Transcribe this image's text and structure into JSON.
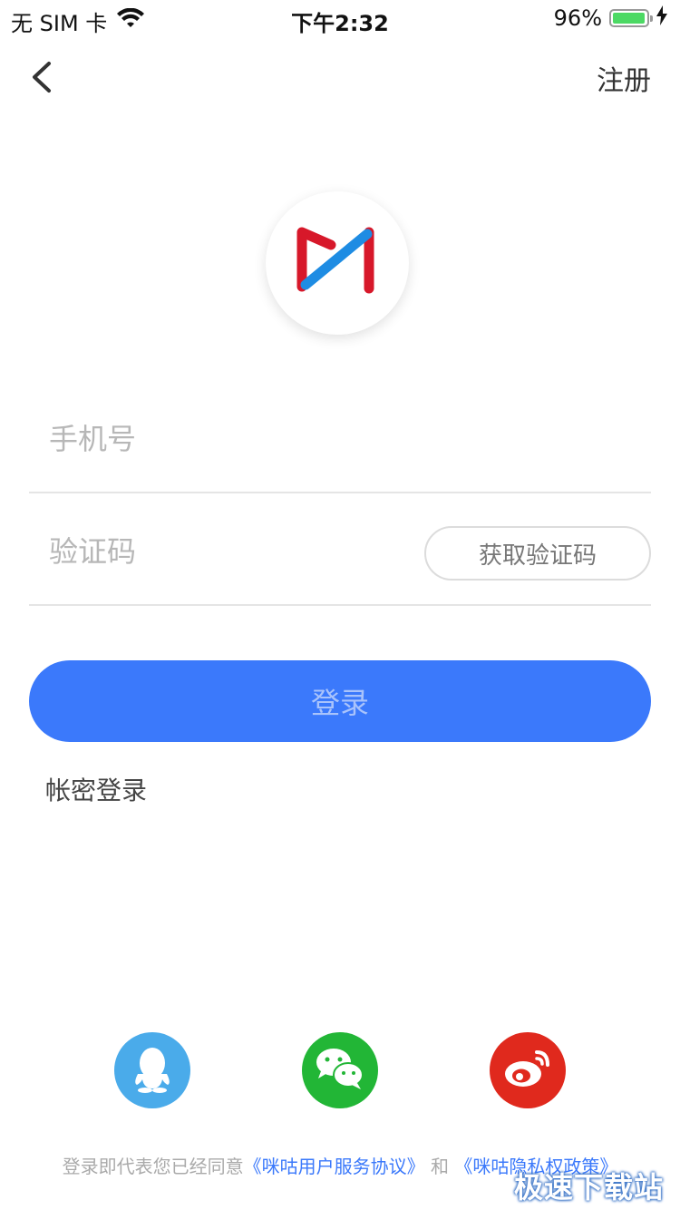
{
  "status_bar": {
    "carrier": "无 SIM 卡",
    "time": "下午2:32",
    "battery_text": "96%",
    "battery_level": 0.96,
    "battery_color": "#4cd964"
  },
  "nav": {
    "back_icon": "chevron-left-icon",
    "register_label": "注册"
  },
  "logo": {
    "name": "migu-logo-icon",
    "red": "#d7182a",
    "blue": "#1e8ce3"
  },
  "form": {
    "phone_placeholder": "手机号",
    "code_placeholder": "验证码",
    "get_code_label": "获取验证码",
    "login_label": "登录",
    "password_login_label": "帐密登录"
  },
  "social": [
    {
      "name": "qq-icon",
      "color": "#4aabea"
    },
    {
      "name": "wechat-icon",
      "color": "#22b636"
    },
    {
      "name": "weibo-icon",
      "color": "#e0291d"
    }
  ],
  "agreement": {
    "prefix": "登录即代表您已经同意",
    "user_agreement": "《咪咕用户服务协议》",
    "conjunction": "和",
    "privacy_policy": "《咪咕隐私权政策》"
  },
  "watermark": "极速下载站",
  "accent_color": "#3b79fb"
}
